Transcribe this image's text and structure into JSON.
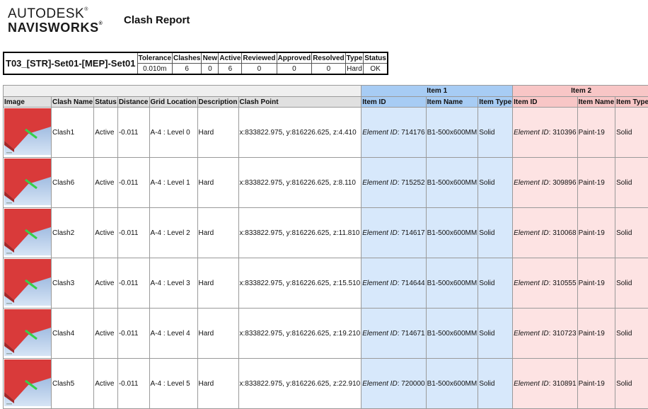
{
  "logo": {
    "line1": "AUTODESK",
    "line2": "NAVISWORKS",
    "reg": "®"
  },
  "report_title": "Clash Report",
  "summary": {
    "test_name": "T03_[STR]-Set01-[MEP]-Set01",
    "headers": [
      "Tolerance",
      "Clashes",
      "New",
      "Active",
      "Reviewed",
      "Approved",
      "Resolved",
      "Type",
      "Status"
    ],
    "values": [
      "0.010m",
      "6",
      "0",
      "6",
      "0",
      "0",
      "0",
      "Hard",
      "OK"
    ]
  },
  "table": {
    "group_item1": "Item 1",
    "group_item2": "Item 2",
    "columns": [
      "Image",
      "Clash Name",
      "Status",
      "Distance",
      "Grid Location",
      "Description",
      "Clash Point",
      "Item ID",
      "Item Name",
      "Item Type",
      "Item ID",
      "Item Name",
      "Item Type"
    ],
    "element_id_label": "Element ID",
    "rows": [
      {
        "name": "Clash1",
        "status": "Active",
        "distance": "-0.011",
        "grid": "A-4 : Level 0",
        "description": "Hard",
        "point": "x:833822.975, y:816226.625, z:4.410",
        "item1_id": "714176",
        "item1_name": "B1-500x600MM",
        "item1_type": "Solid",
        "item2_id": "310396",
        "item2_name": "Paint-19",
        "item2_type": "Solid"
      },
      {
        "name": "Clash6",
        "status": "Active",
        "distance": "-0.011",
        "grid": "A-4 : Level 1",
        "description": "Hard",
        "point": "x:833822.975, y:816226.625, z:8.110",
        "item1_id": "715252",
        "item1_name": "B1-500x600MM",
        "item1_type": "Solid",
        "item2_id": "309896",
        "item2_name": "Paint-19",
        "item2_type": "Solid"
      },
      {
        "name": "Clash2",
        "status": "Active",
        "distance": "-0.011",
        "grid": "A-4 : Level 2",
        "description": "Hard",
        "point": "x:833822.975, y:816226.625, z:11.810",
        "item1_id": "714617",
        "item1_name": "B1-500x600MM",
        "item1_type": "Solid",
        "item2_id": "310068",
        "item2_name": "Paint-19",
        "item2_type": "Solid"
      },
      {
        "name": "Clash3",
        "status": "Active",
        "distance": "-0.011",
        "grid": "A-4 : Level 3",
        "description": "Hard",
        "point": "x:833822.975, y:816226.625, z:15.510",
        "item1_id": "714644",
        "item1_name": "B1-500x600MM",
        "item1_type": "Solid",
        "item2_id": "310555",
        "item2_name": "Paint-19",
        "item2_type": "Solid"
      },
      {
        "name": "Clash4",
        "status": "Active",
        "distance": "-0.011",
        "grid": "A-4 : Level 4",
        "description": "Hard",
        "point": "x:833822.975, y:816226.625, z:19.210",
        "item1_id": "714671",
        "item1_name": "B1-500x600MM",
        "item1_type": "Solid",
        "item2_id": "310723",
        "item2_name": "Paint-19",
        "item2_type": "Solid"
      },
      {
        "name": "Clash5",
        "status": "Active",
        "distance": "-0.011",
        "grid": "A-4 : Level 5",
        "description": "Hard",
        "point": "x:833822.975, y:816226.625, z:22.910",
        "item1_id": "720000",
        "item1_name": "B1-500x600MM",
        "item1_type": "Solid",
        "item2_id": "310891",
        "item2_name": "Paint-19",
        "item2_type": "Solid"
      }
    ]
  },
  "colors": {
    "item1_header": "#a7ccf4",
    "item1_cell": "#d7e8fb",
    "item2_header": "#f8c6c6",
    "item2_cell": "#fde3e3",
    "thumb_red": "#d93a3a",
    "thumb_green": "#35d14a"
  }
}
